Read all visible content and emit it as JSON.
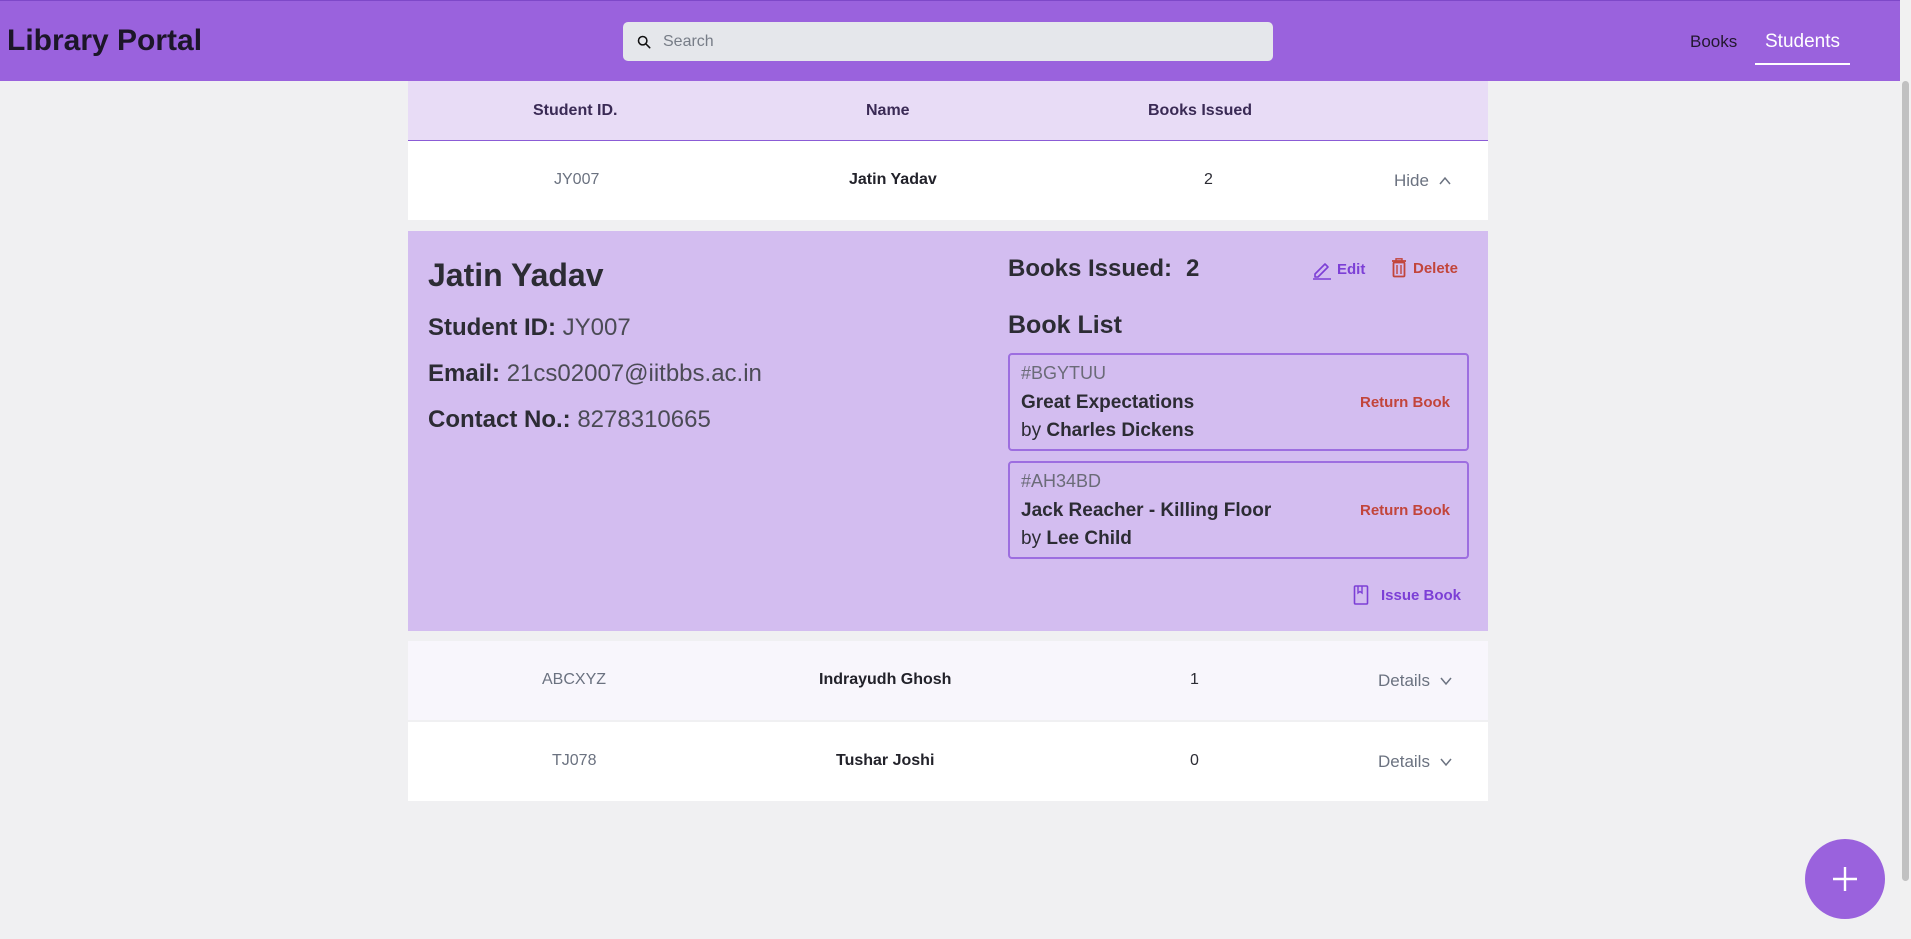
{
  "header": {
    "title": "Library Portal",
    "search_placeholder": "Search",
    "nav": {
      "books": "Books",
      "students": "Students"
    }
  },
  "table": {
    "columns": [
      "Student ID.",
      "Name",
      "Books Issued"
    ],
    "rows": [
      {
        "id": "JY007",
        "name": "Jatin Yadav",
        "books_issued": "2",
        "toggle": "Hide",
        "expanded": true
      },
      {
        "id": "ABCXYZ",
        "name": "Indrayudh Ghosh",
        "books_issued": "1",
        "toggle": "Details",
        "expanded": false
      },
      {
        "id": "TJ078",
        "name": "Tushar Joshi",
        "books_issued": "0",
        "toggle": "Details",
        "expanded": false
      }
    ]
  },
  "detail": {
    "name": "Jatin Yadav",
    "student_id_label": "Student ID:",
    "student_id": "JY007",
    "email_label": "Email:",
    "email": "21cs02007@iitbbs.ac.in",
    "contact_label": "Contact No.:",
    "contact": "8278310665",
    "books_issued_label": "Books Issued:",
    "books_issued": "2",
    "edit_label": "Edit",
    "delete_label": "Delete",
    "book_list_label": "Book List",
    "books": [
      {
        "code": "#BGYTUU",
        "title": "Great Expectations",
        "by": "by",
        "author": "Charles Dickens",
        "action": "Return Book"
      },
      {
        "code": "#AH34BD",
        "title": "Jack Reacher - Killing Floor",
        "by": "by",
        "author": "Lee Child",
        "action": "Return Book"
      }
    ],
    "issue_label": "Issue Book"
  },
  "colors": {
    "primary": "#9a62dd",
    "detail_bg": "#d3bdf0",
    "danger": "#c2453b",
    "accent": "#7c3fd6"
  },
  "icons": {
    "search": "search-icon",
    "edit": "pencil-icon",
    "delete": "trash-icon",
    "issue": "book-icon",
    "hide": "chevron-up-icon",
    "details": "chevron-down-icon",
    "add": "plus-icon"
  }
}
